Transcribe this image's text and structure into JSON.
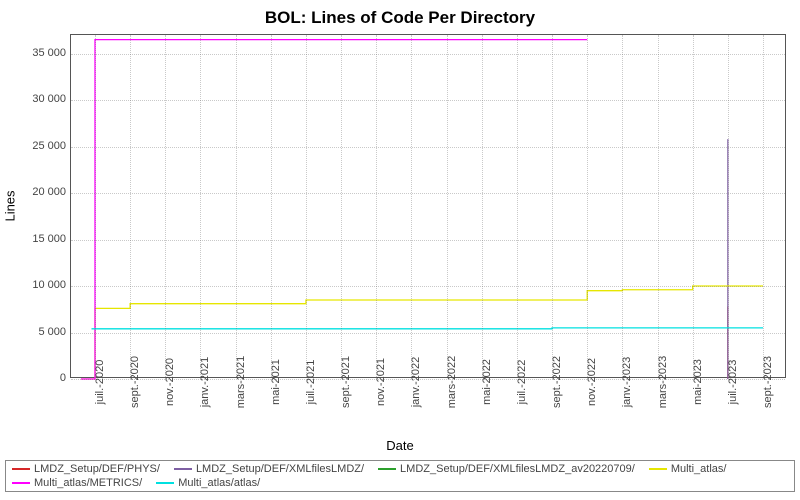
{
  "chart_data": {
    "type": "line",
    "title": "BOL: Lines of Code Per Directory",
    "xlabel": "Date",
    "ylabel": "Lines",
    "ylim": [
      0,
      37000
    ],
    "yticks": [
      0,
      5000,
      10000,
      15000,
      20000,
      25000,
      30000,
      35000
    ],
    "ytick_labels": [
      "0",
      "5 000",
      "10 000",
      "15 000",
      "20 000",
      "25 000",
      "30 000",
      "35 000"
    ],
    "x": [
      "juil.-2020",
      "sept.-2020",
      "nov.-2020",
      "janv.-2021",
      "mars-2021",
      "mai-2021",
      "juil.-2021",
      "sept.-2021",
      "nov.-2021",
      "janv.-2022",
      "mars-2022",
      "mai-2022",
      "juil.-2022",
      "sept.-2022",
      "nov.-2022",
      "janv.-2023",
      "mars-2023",
      "mai-2023",
      "juil.-2023",
      "sept.-2023"
    ],
    "series": [
      {
        "name": "LMDZ_Setup/DEF/PHYS/",
        "color": "#d62728",
        "values": [
          null,
          null,
          null,
          null,
          null,
          null,
          null,
          null,
          null,
          null,
          null,
          null,
          null,
          null,
          null,
          null,
          null,
          null,
          7800,
          null
        ]
      },
      {
        "name": "LMDZ_Setup/DEF/XMLfilesLMDZ/",
        "color": "#7e5fa3",
        "values": [
          null,
          null,
          null,
          null,
          null,
          null,
          null,
          null,
          null,
          null,
          null,
          null,
          null,
          null,
          null,
          null,
          null,
          null,
          25800,
          null
        ]
      },
      {
        "name": "LMDZ_Setup/DEF/XMLfilesLMDZ_av20220709/",
        "color": "#2ca02c",
        "values": [
          null,
          null,
          null,
          null,
          null,
          null,
          null,
          null,
          null,
          null,
          null,
          null,
          null,
          null,
          null,
          null,
          null,
          null,
          null,
          null
        ]
      },
      {
        "name": "Multi_atlas/",
        "color": "#e6e600",
        "values": [
          7600,
          8100,
          8100,
          8100,
          8100,
          8100,
          8500,
          8500,
          8500,
          8500,
          8500,
          8500,
          8500,
          8500,
          9500,
          9600,
          9600,
          10000,
          10000,
          10000
        ]
      },
      {
        "name": "Multi_atlas/METRICS/",
        "color": "#ff00ff",
        "values": [
          36500,
          36500,
          36500,
          36500,
          36500,
          36500,
          36500,
          36500,
          36500,
          36500,
          36500,
          36500,
          36500,
          36500,
          36500,
          null,
          null,
          null,
          null,
          null
        ]
      },
      {
        "name": "Multi_atlas/atlas/",
        "color": "#00e0e0",
        "values": [
          5400,
          5400,
          5400,
          5400,
          5400,
          5400,
          5400,
          5400,
          5400,
          5400,
          5400,
          5400,
          5400,
          5500,
          5500,
          5500,
          5500,
          5500,
          5500,
          5500
        ]
      }
    ],
    "extra_start": {
      "Multi_atlas/": {
        "at": -0.4,
        "from": 0
      },
      "Multi_atlas/METRICS/": {
        "at": -0.4,
        "from": 0
      },
      "Multi_atlas/atlas/": {
        "at": -0.1,
        "from": 5400
      }
    }
  }
}
